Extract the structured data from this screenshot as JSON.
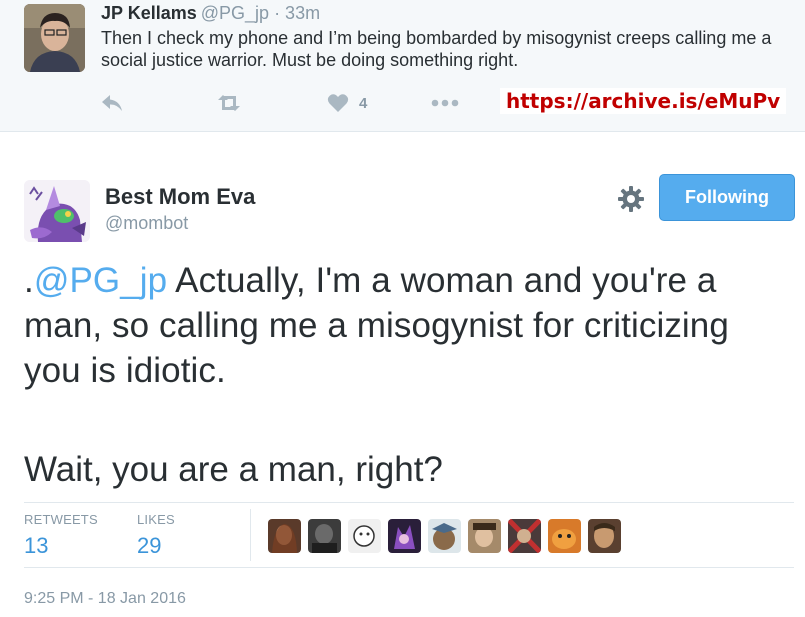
{
  "reply_tweet": {
    "name": "JP Kellams",
    "handle": "@PG_jp",
    "time": "· 33m",
    "text": "Then I check my phone and I’m being bombarded by misogynist creeps calling me a social justice warrior.  Must be doing something right.",
    "like_count": "4",
    "archive_link": "https://archive.is/eMuPv",
    "icons": [
      "reply-icon",
      "retweet-icon",
      "heart-icon",
      "more-icon"
    ]
  },
  "main_tweet": {
    "name": "Best Mom Eva",
    "handle": "@mombot",
    "follow_label": "Following",
    "mention": "@PG_jp",
    "text_prefix": ".",
    "text_body": " Actually, I'm a woman and you're a man, so calling me a misogynist for criticizing you is idiotic.",
    "text_line2": "Wait, you are a man, right?",
    "retweets_label": "RETWEETS",
    "retweets_value": "13",
    "likes_label": "LIKES",
    "likes_value": "29",
    "timestamp": "9:25 PM - 18 Jan 2016"
  },
  "colors": {
    "accent": "#55acee",
    "link_blue": "#3b94d9",
    "muted": "#8899a6",
    "text": "#292f33",
    "archive_red": "#c00000",
    "reply_bg": "#f5f8fa"
  }
}
